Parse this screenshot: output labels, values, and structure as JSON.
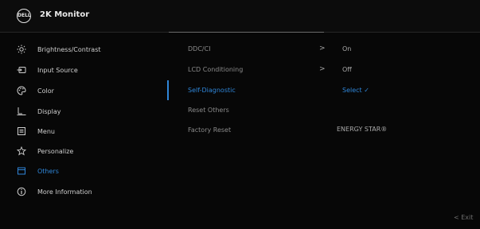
{
  "header": {
    "logo_text": "DELL",
    "title": "2K Monitor"
  },
  "sidebar": {
    "items": [
      {
        "label": "Brightness/Contrast",
        "icon": "brightness-icon"
      },
      {
        "label": "Input Source",
        "icon": "input-source-icon"
      },
      {
        "label": "Color",
        "icon": "color-palette-icon"
      },
      {
        "label": "Display",
        "icon": "display-icon"
      },
      {
        "label": "Menu",
        "icon": "menu-icon"
      },
      {
        "label": "Personalize",
        "icon": "star-icon"
      },
      {
        "label": "Others",
        "icon": "others-icon"
      },
      {
        "label": "More Information",
        "icon": "info-icon"
      }
    ],
    "active_index": 6
  },
  "options": [
    {
      "label": "DDC/CI",
      "value": "On",
      "chevron": ">"
    },
    {
      "label": "LCD Conditioning",
      "value": "Off",
      "chevron": ">"
    },
    {
      "label": "Self-Diagnostic",
      "value": "Select ✓"
    },
    {
      "label": "Reset Others",
      "value": ""
    },
    {
      "label": "Factory Reset",
      "value": "ENERGY STAR®"
    }
  ],
  "footer": {
    "exit_label": "< Exit"
  },
  "colors": {
    "accent": "#2f86d8",
    "background": "#070707",
    "text": "#cfcfcf"
  }
}
